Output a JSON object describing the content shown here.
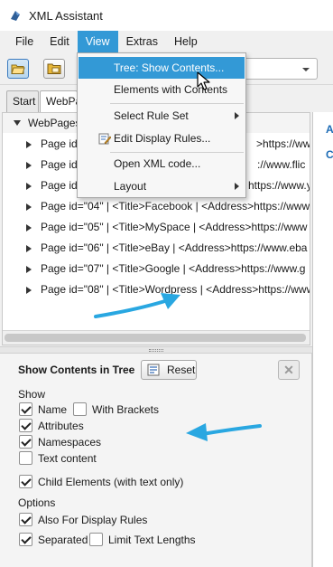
{
  "window": {
    "title": "XML Assistant"
  },
  "menubar": {
    "items": [
      "File",
      "Edit",
      "View",
      "Extras",
      "Help"
    ],
    "active": "View"
  },
  "view_menu": {
    "items": [
      {
        "label": "Tree: Show Contents...",
        "highlighted": true
      },
      {
        "label": "Elements with Contents"
      },
      {
        "label": "Select Rule Set",
        "submenu": true
      },
      {
        "label": "Edit Display Rules...",
        "icon": "edit-rules-icon"
      },
      {
        "label": "Open XML code..."
      },
      {
        "label": "Layout",
        "submenu": true
      }
    ]
  },
  "tabs": [
    "Start",
    "WebPa"
  ],
  "tree": {
    "root": "WebPages",
    "rows": [
      {
        "left": "Page id=",
        "right": ">https://www"
      },
      {
        "left": "Page id=",
        "right": "://www.flic"
      },
      {
        "left": "Page id=",
        "right": "https://www.ya"
      },
      {
        "label": "Page id=\"04\" | <Title>Facebook | <Address>https://www"
      },
      {
        "label": "Page id=\"05\" | <Title>MySpace | <Address>https://www"
      },
      {
        "label": "Page id=\"06\" | <Title>eBay | <Address>https://www.eba"
      },
      {
        "label": "Page id=\"07\" | <Title>Google | <Address>https://www.g"
      },
      {
        "label": "Page id=\"08\" | <Title>Wordpress | <Address>https://www"
      }
    ]
  },
  "right_panel": {
    "fragments": [
      "A",
      "C"
    ]
  },
  "options_panel": {
    "title": "Show Contents in Tree",
    "reset_label": "Reset",
    "show_label": "Show",
    "options_label": "Options",
    "checkboxes": {
      "name": {
        "label": "Name",
        "checked": true
      },
      "with_brackets": {
        "label": "With Brackets",
        "checked": false
      },
      "attributes": {
        "label": "Attributes",
        "checked": true
      },
      "namespaces": {
        "label": "Namespaces",
        "checked": true
      },
      "text_content": {
        "label": "Text content",
        "checked": false
      },
      "child_elements": {
        "label": "Child Elements (with text only)",
        "checked": true
      },
      "also_display_rules": {
        "label": "Also For Display Rules",
        "checked": true
      },
      "separated": {
        "label": "Separated",
        "checked": true
      },
      "limit_text": {
        "label": "Limit Text Lengths",
        "checked": false
      }
    }
  },
  "colors": {
    "accent": "#3399d6",
    "annotation_arrow": "#29a7e1"
  }
}
